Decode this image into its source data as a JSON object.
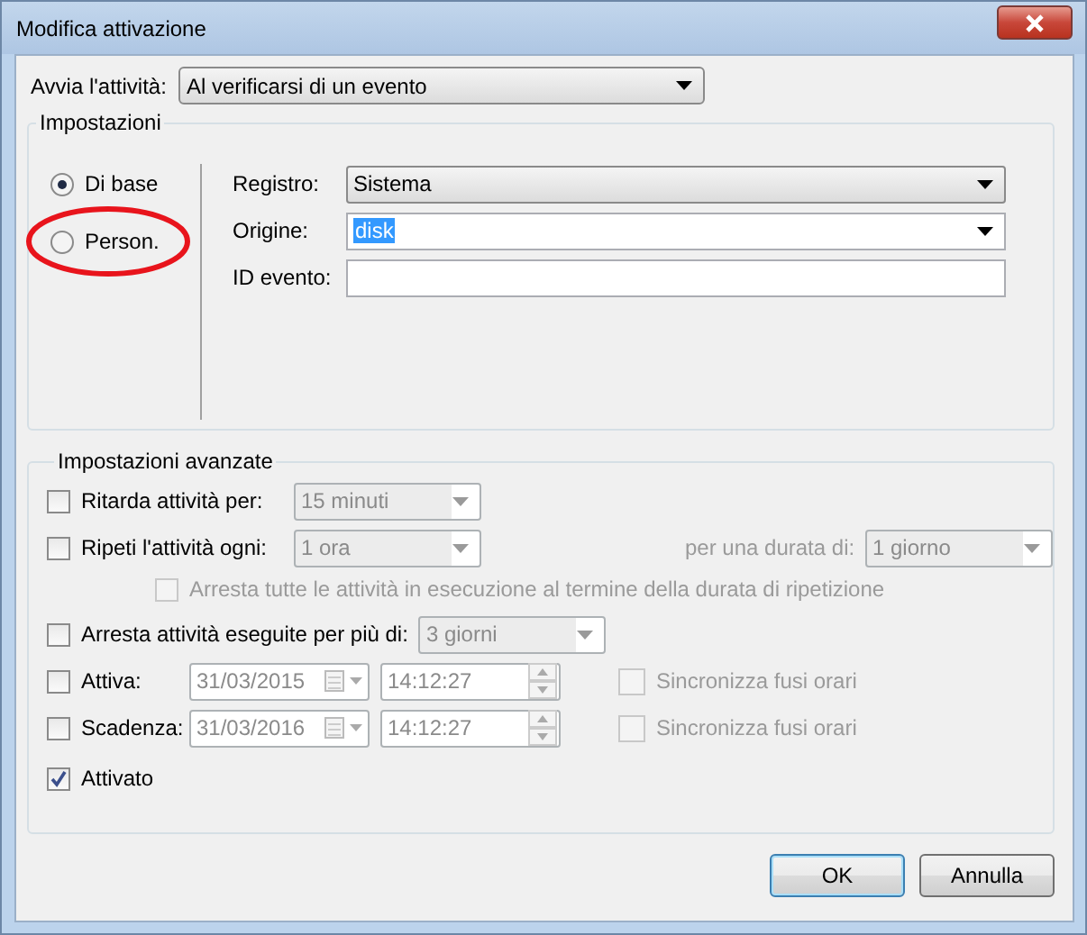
{
  "window": {
    "title": "Modifica attivazione"
  },
  "start": {
    "label": "Avvia l'attività:",
    "value": "Al verificarsi di un evento"
  },
  "settings": {
    "legend": "Impostazioni",
    "modes": [
      {
        "label": "Di base",
        "selected": true,
        "circled": false
      },
      {
        "label": "Person.",
        "selected": false,
        "circled": true
      }
    ],
    "fields": [
      {
        "kind": "dropdown",
        "label": "Registro:",
        "value": "Sistema"
      },
      {
        "kind": "combo",
        "label": "Origine:",
        "value": "disk",
        "value_selected": true
      },
      {
        "kind": "text",
        "label": "ID evento:"
      }
    ]
  },
  "advanced": {
    "legend": "Impostazioni avanzate",
    "rows": [
      {
        "kind": "combo",
        "label": "Ritarda attività per:",
        "checked": false,
        "value": "15 minuti",
        "disabled": true
      },
      {
        "kind": "repeat",
        "label": "Ripeti l'attività ogni:",
        "checked": false,
        "value": "1 ora",
        "disabled": true,
        "duration_label": "per una durata di:",
        "duration_value": "1 giorno"
      },
      {
        "kind": "subcheck",
        "label": "Arresta tutte le attività in esecuzione al termine della durata di ripetizione",
        "checked": false,
        "disabled": true
      },
      {
        "kind": "combo",
        "label": "Arresta attività eseguite per più di:",
        "checked": false,
        "value": "3 giorni",
        "disabled": true
      },
      {
        "kind": "date",
        "label": "Attiva:",
        "checked": false,
        "date": "31/03/2015",
        "time": "14:12:27",
        "sync_label": "Sincronizza fusi orari",
        "sync_checked": false,
        "disabled": true
      },
      {
        "kind": "date",
        "label": "Scadenza:",
        "checked": false,
        "date": "31/03/2016",
        "time": "14:12:27",
        "sync_label": "Sincronizza fusi orari",
        "sync_checked": false,
        "disabled": true
      },
      {
        "kind": "check",
        "label": "Attivato",
        "checked": true
      }
    ]
  },
  "buttons": [
    {
      "label": "OK",
      "default": true
    },
    {
      "label": "Annulla",
      "default": false
    }
  ]
}
